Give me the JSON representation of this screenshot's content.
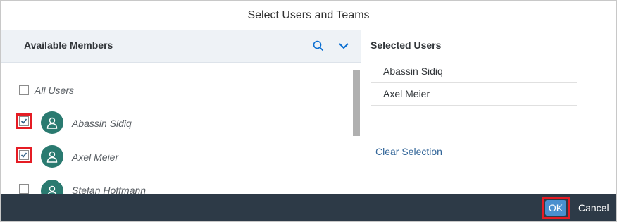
{
  "dialog": {
    "title": "Select Users and Teams"
  },
  "available": {
    "header": "Available Members",
    "all_users_label": "All Users",
    "members": [
      {
        "name": "Abassin Sidiq",
        "checked": true
      },
      {
        "name": "Axel Meier",
        "checked": true
      },
      {
        "name": "Stefan Hoffmann",
        "checked": false
      }
    ]
  },
  "selected": {
    "header": "Selected Users",
    "items": [
      "Abassin Sidiq",
      "Axel Meier"
    ],
    "clear_label": "Clear Selection"
  },
  "footer": {
    "ok_label": "OK",
    "cancel_label": "Cancel"
  },
  "colors": {
    "accent": "#4a90cf",
    "avatar": "#2a7a70",
    "footer_bg": "#2d3a47",
    "highlight": "#e51c24",
    "link": "#336699"
  },
  "icons": {
    "search": "search-icon",
    "expand": "chevron-down-icon",
    "avatar": "person-icon"
  }
}
